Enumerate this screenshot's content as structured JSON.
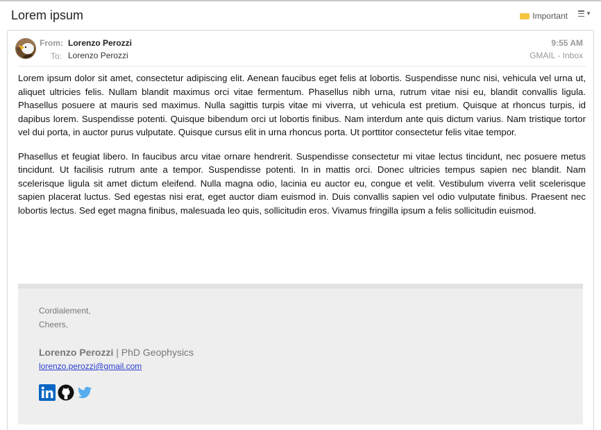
{
  "email": {
    "subject": "Lorem ipsum",
    "important_label": "Important",
    "header": {
      "from_label": "From:",
      "from_name": "Lorenzo Perozzi",
      "to_label": "To:",
      "to_name": "Lorenzo Perozzi",
      "time": "9:55 AM",
      "folder": "GMAIL - Inbox"
    },
    "body": [
      "Lorem ipsum dolor sit amet, consectetur adipiscing elit. Aenean faucibus eget felis at lobortis. Suspendisse nunc nisi, vehicula vel urna ut, aliquet ultricies felis. Nullam blandit maximus orci vitae fermentum. Phasellus nibh urna, rutrum vitae nisi eu, blandit convallis ligula. Phasellus posuere at mauris sed maximus. Nulla sagittis turpis vitae mi viverra, ut vehicula est pretium. Quisque at rhoncus turpis, id dapibus lorem. Suspendisse potenti. Quisque bibendum orci ut lobortis finibus. Nam interdum ante quis dictum varius. Nam tristique tortor vel dui porta, in auctor purus vulputate. Quisque cursus elit in urna rhoncus porta. Ut porttitor consectetur felis vitae tempor.",
      "Phasellus et feugiat libero. In faucibus arcu vitae ornare hendrerit. Suspendisse consectetur mi vitae lectus tincidunt, nec posuere metus tincidunt. Ut facilisis rutrum ante a tempor. Suspendisse potenti. In in mattis orci. Donec ultricies tempus sapien nec blandit. Nam scelerisque ligula sit amet dictum eleifend. Nulla magna odio, lacinia eu auctor eu, congue et velit. Vestibulum viverra velit scelerisque sapien placerat luctus. Sed egestas nisi erat, eget auctor diam euismod in. Duis convallis sapien vel odio vulputate finibus. Praesent nec lobortis lectus. Sed eget magna finibus, malesuada leo quis, sollicitudin eros. Vivamus fringilla ipsum a felis sollicitudin euismod."
    ],
    "signature": {
      "greeting1": "Cordialement,",
      "greeting2": "Cheers,",
      "name": "Lorenzo Perozzi",
      "separator": " | ",
      "title": "PhD Geophysics",
      "email": "lorenzo.perozzi@gmail.com",
      "social_icons": [
        "linkedin-icon",
        "github-icon",
        "twitter-icon"
      ]
    }
  },
  "colors": {
    "important_tag": "#f5c542",
    "link": "#2a3ed0",
    "linkedin": "#0a66c2",
    "github": "#111111",
    "twitter": "#55acee",
    "signature_bg": "#eeeeee"
  }
}
